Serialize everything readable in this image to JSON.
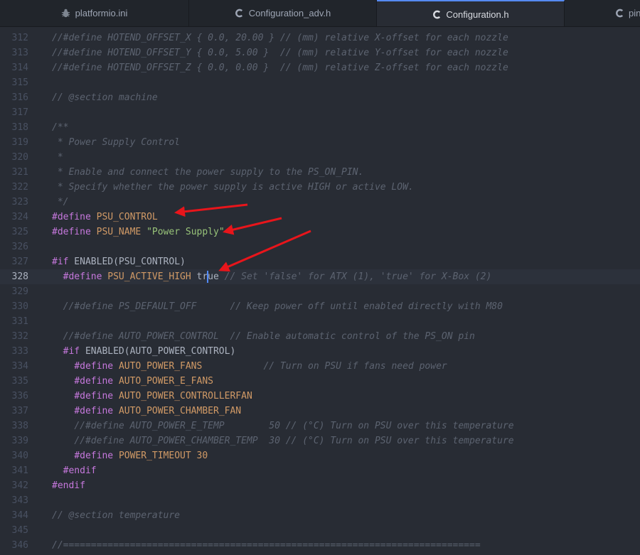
{
  "tabs": [
    {
      "label": "platformio.ini",
      "icon": "bug-icon",
      "active": false
    },
    {
      "label": "Configuration_adv.h",
      "icon": "c-file-icon",
      "active": false
    },
    {
      "label": "Configuration.h",
      "icon": "c-file-icon",
      "active": true
    },
    {
      "label": "pins",
      "icon": "c-file-icon",
      "active": false
    }
  ],
  "current_line": 328,
  "colors": {
    "accent": "#568af2",
    "arrow": "#e8151b",
    "comment": "#5c6370",
    "keyword": "#c678dd",
    "macro": "#d19a66",
    "string": "#98c379"
  },
  "lines": [
    {
      "n": 312,
      "t": [
        [
          "cm",
          "//#define HOTEND_OFFSET_X { 0.0, 20.00 } // (mm) relative X-offset for each nozzle"
        ]
      ]
    },
    {
      "n": 313,
      "t": [
        [
          "cm",
          "//#define HOTEND_OFFSET_Y { 0.0, 5.00 }  // (mm) relative Y-offset for each nozzle"
        ]
      ]
    },
    {
      "n": 314,
      "t": [
        [
          "cm",
          "//#define HOTEND_OFFSET_Z { 0.0, 0.00 }  // (mm) relative Z-offset for each nozzle"
        ]
      ]
    },
    {
      "n": 315,
      "t": []
    },
    {
      "n": 316,
      "t": [
        [
          "cm",
          "// @section machine"
        ]
      ]
    },
    {
      "n": 317,
      "t": []
    },
    {
      "n": 318,
      "t": [
        [
          "cm",
          "/**"
        ]
      ]
    },
    {
      "n": 319,
      "t": [
        [
          "cm",
          " * Power Supply Control"
        ]
      ]
    },
    {
      "n": 320,
      "t": [
        [
          "cm",
          " *"
        ]
      ]
    },
    {
      "n": 321,
      "t": [
        [
          "cm",
          " * Enable and connect the power supply to the PS_ON_PIN."
        ]
      ]
    },
    {
      "n": 322,
      "t": [
        [
          "cm",
          " * Specify whether the power supply is active HIGH or active LOW."
        ]
      ]
    },
    {
      "n": 323,
      "t": [
        [
          "cm",
          " */"
        ]
      ]
    },
    {
      "n": 324,
      "t": [
        [
          "kw",
          "#define"
        ],
        [
          "txt",
          " "
        ],
        [
          "id",
          "PSU_CONTROL"
        ]
      ]
    },
    {
      "n": 325,
      "t": [
        [
          "kw",
          "#define"
        ],
        [
          "txt",
          " "
        ],
        [
          "id",
          "PSU_NAME"
        ],
        [
          "txt",
          " "
        ],
        [
          "str",
          "\"Power Supply\""
        ]
      ]
    },
    {
      "n": 326,
      "t": []
    },
    {
      "n": 327,
      "t": [
        [
          "kw",
          "#if"
        ],
        [
          "txt",
          " ENABLED(PSU_CONTROL)"
        ]
      ]
    },
    {
      "n": 328,
      "t": [
        [
          "txt",
          "  "
        ],
        [
          "kw",
          "#define"
        ],
        [
          "txt",
          " "
        ],
        [
          "id",
          "PSU_ACTIVE_HIGH"
        ],
        [
          "txt",
          " tr"
        ],
        [
          "cursor",
          ""
        ],
        [
          "txt",
          "ue"
        ],
        [
          "txt",
          " "
        ],
        [
          "cm",
          "// Set 'false' for ATX (1), 'true' for X-Box (2)"
        ]
      ]
    },
    {
      "n": 329,
      "t": []
    },
    {
      "n": 330,
      "t": [
        [
          "txt",
          "  "
        ],
        [
          "cm",
          "//#define PS_DEFAULT_OFF      // Keep power off until enabled directly with M80"
        ]
      ]
    },
    {
      "n": 331,
      "t": []
    },
    {
      "n": 332,
      "t": [
        [
          "txt",
          "  "
        ],
        [
          "cm",
          "//#define AUTO_POWER_CONTROL  // Enable automatic control of the PS_ON pin"
        ]
      ]
    },
    {
      "n": 333,
      "t": [
        [
          "txt",
          "  "
        ],
        [
          "kw",
          "#if"
        ],
        [
          "txt",
          " ENABLED(AUTO_POWER_CONTROL)"
        ]
      ]
    },
    {
      "n": 334,
      "t": [
        [
          "txt",
          "    "
        ],
        [
          "kw",
          "#define"
        ],
        [
          "txt",
          " "
        ],
        [
          "id",
          "AUTO_POWER_FANS"
        ],
        [
          "txt",
          "           "
        ],
        [
          "cm",
          "// Turn on PSU if fans need power"
        ]
      ]
    },
    {
      "n": 335,
      "t": [
        [
          "txt",
          "    "
        ],
        [
          "kw",
          "#define"
        ],
        [
          "txt",
          " "
        ],
        [
          "id",
          "AUTO_POWER_E_FANS"
        ]
      ]
    },
    {
      "n": 336,
      "t": [
        [
          "txt",
          "    "
        ],
        [
          "kw",
          "#define"
        ],
        [
          "txt",
          " "
        ],
        [
          "id",
          "AUTO_POWER_CONTROLLERFAN"
        ]
      ]
    },
    {
      "n": 337,
      "t": [
        [
          "txt",
          "    "
        ],
        [
          "kw",
          "#define"
        ],
        [
          "txt",
          " "
        ],
        [
          "id",
          "AUTO_POWER_CHAMBER_FAN"
        ]
      ]
    },
    {
      "n": 338,
      "t": [
        [
          "txt",
          "    "
        ],
        [
          "cm",
          "//#define AUTO_POWER_E_TEMP        50 // (°C) Turn on PSU over this temperature"
        ]
      ]
    },
    {
      "n": 339,
      "t": [
        [
          "txt",
          "    "
        ],
        [
          "cm",
          "//#define AUTO_POWER_CHAMBER_TEMP  30 // (°C) Turn on PSU over this temperature"
        ]
      ]
    },
    {
      "n": 340,
      "t": [
        [
          "txt",
          "    "
        ],
        [
          "kw",
          "#define"
        ],
        [
          "txt",
          " "
        ],
        [
          "id",
          "POWER_TIMEOUT"
        ],
        [
          "txt",
          " "
        ],
        [
          "num",
          "30"
        ]
      ]
    },
    {
      "n": 341,
      "t": [
        [
          "txt",
          "  "
        ],
        [
          "kw",
          "#endif"
        ]
      ]
    },
    {
      "n": 342,
      "t": [
        [
          "kw",
          "#endif"
        ]
      ]
    },
    {
      "n": 343,
      "t": []
    },
    {
      "n": 344,
      "t": [
        [
          "cm",
          "// @section temperature"
        ]
      ]
    },
    {
      "n": 345,
      "t": []
    },
    {
      "n": 346,
      "t": [
        [
          "cm",
          "//==========================================================================="
        ]
      ]
    }
  ]
}
